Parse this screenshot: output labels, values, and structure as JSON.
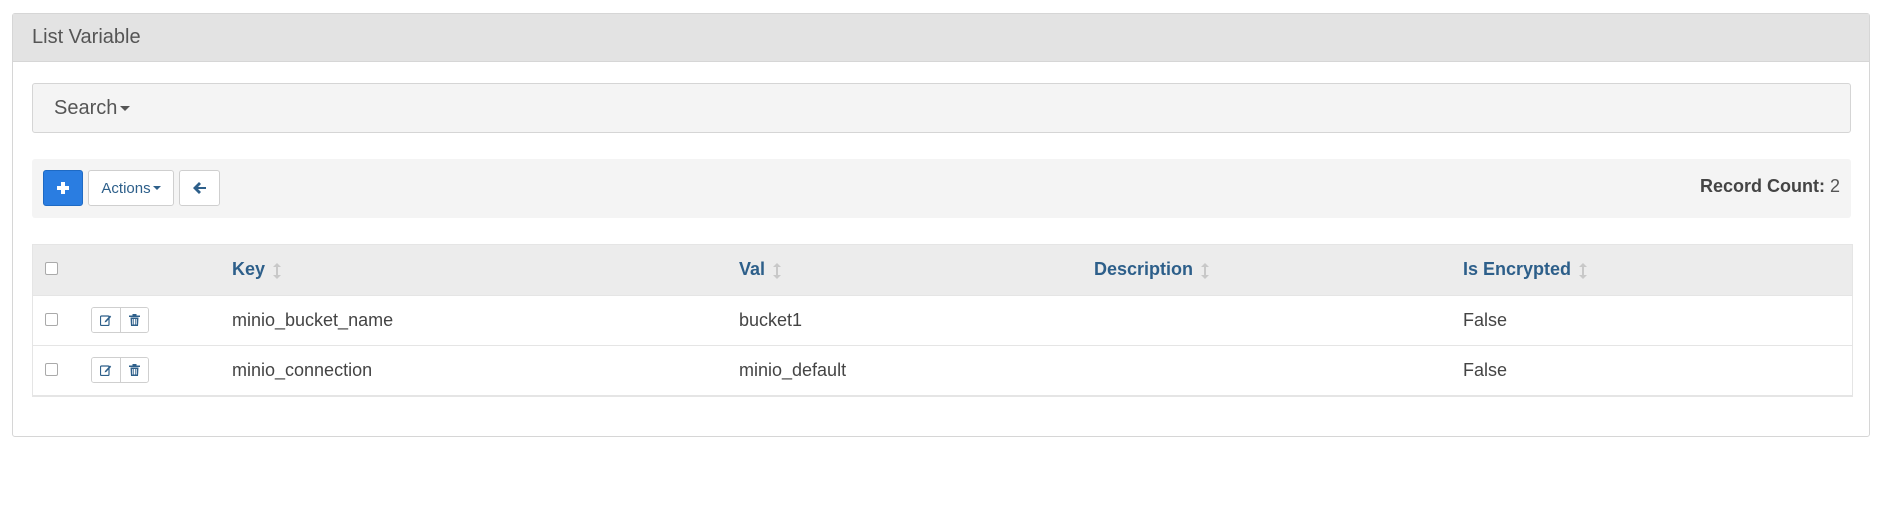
{
  "panel": {
    "title": "List Variable"
  },
  "search": {
    "label": "Search"
  },
  "toolbar": {
    "actions_label": "Actions",
    "record_count_label": "Record Count:",
    "record_count_value": "2"
  },
  "table": {
    "columns": [
      "Key",
      "Val",
      "Description",
      "Is Encrypted"
    ],
    "rows": [
      {
        "key": "minio_bucket_name",
        "val": "bucket1",
        "description": "",
        "is_encrypted": "False"
      },
      {
        "key": "minio_connection",
        "val": "minio_default",
        "description": "",
        "is_encrypted": "False"
      }
    ]
  },
  "colors": {
    "primary": "#2a7de1",
    "header_link": "#2d5f8a",
    "panel_heading_bg": "#e3e3e3"
  },
  "icons": {
    "add": "plus-icon",
    "back": "arrow-left-icon",
    "edit": "edit-icon",
    "delete": "trash-icon",
    "sort": "sort-icon"
  }
}
